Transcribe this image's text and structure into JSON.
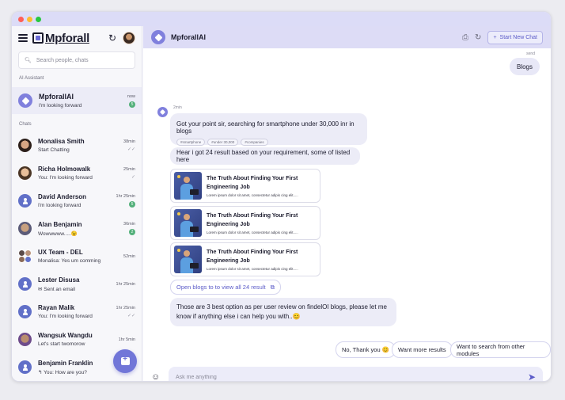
{
  "colors": {
    "accent": "#7176d8",
    "window_dot_red": "#ff5f57",
    "window_dot_yellow": "#febc2e",
    "window_dot_green": "#28c840",
    "header_bg": "#dddcf6"
  },
  "sidebar": {
    "logo": "Mpforall",
    "search_placeholder": "Search people, chats",
    "ai_section_label": "AI Assistant",
    "ai_item": {
      "name": "MpforallAI",
      "message": "I'm looking forward",
      "time": "now",
      "badge": "5"
    },
    "chats_section_label": "Chats",
    "chats": [
      {
        "name": "Monalisa Smith",
        "message": "Start Chatting",
        "time": "38min",
        "status": "✓✓"
      },
      {
        "name": "Richa Holmowalk",
        "message": "You: I'm looking forward",
        "time": "25min",
        "status": "✓"
      },
      {
        "name": "David Anderson",
        "message": "I'm looking forward",
        "time": "1hr 25min",
        "status": "5"
      },
      {
        "name": "Alan Benjamin",
        "message": "Wowwwww.....😉",
        "time": "36min",
        "status": "2"
      },
      {
        "name": "UX Team - DEL",
        "message": "Monalisa: Yes um comming",
        "time": "52min",
        "status": ""
      },
      {
        "name": "Lester Disusa",
        "message": "✉ Sent an email",
        "time": "1hr 25min",
        "status": ""
      },
      {
        "name": "Rayan Malik",
        "message": "You: I'm looking forward",
        "time": "1hr 25min",
        "status": "✓✓"
      },
      {
        "name": "Wangsuk Wangdu",
        "message": "Let's start twomorow",
        "time": "1hr 5min",
        "status": ""
      },
      {
        "name": "Benjamin Franklin",
        "message": "↰ You: How are you?",
        "time": "",
        "status": ""
      }
    ]
  },
  "header": {
    "title": "MpforallAI",
    "new_chat_label": "Start New Chat"
  },
  "conversation": {
    "send_label": "send",
    "user_message": "Blogs",
    "bot_time": "2min",
    "bot_message_1": "Got your point sir, searching for smartphone under 30,000 inr in blogs",
    "tags": [
      "#smartphone",
      "#under 30,000",
      "#companies"
    ],
    "bot_message_2": "Hear i got 24 result based on your requirement, some of listed here",
    "cards": [
      {
        "title": "The Truth About Finding Your First Engineering Job",
        "desc": "Lorem ipsum dolor sit amet, consectetur adipis cing elit....."
      },
      {
        "title": "The Truth About Finding Your First Engineering Job",
        "desc": "Lorem ipsum dolor sit amet, consectetur adipis cing elit....."
      },
      {
        "title": "The Truth About Finding Your First Engineering Job",
        "desc": "Lorem ipsum dolor sit amet, consectetur adipis cing elit....."
      }
    ],
    "open_link": "Open blogs to to view all 24 result",
    "bot_message_3": "Those are 3 best option as per user review on findelOI blogs, please let me know if anything else i can help you with..😊",
    "quick_replies": [
      "No, Thank you 😊",
      "Want more results",
      "Want to search from other modules"
    ]
  },
  "composer": {
    "placeholder": "Ask me anything"
  }
}
